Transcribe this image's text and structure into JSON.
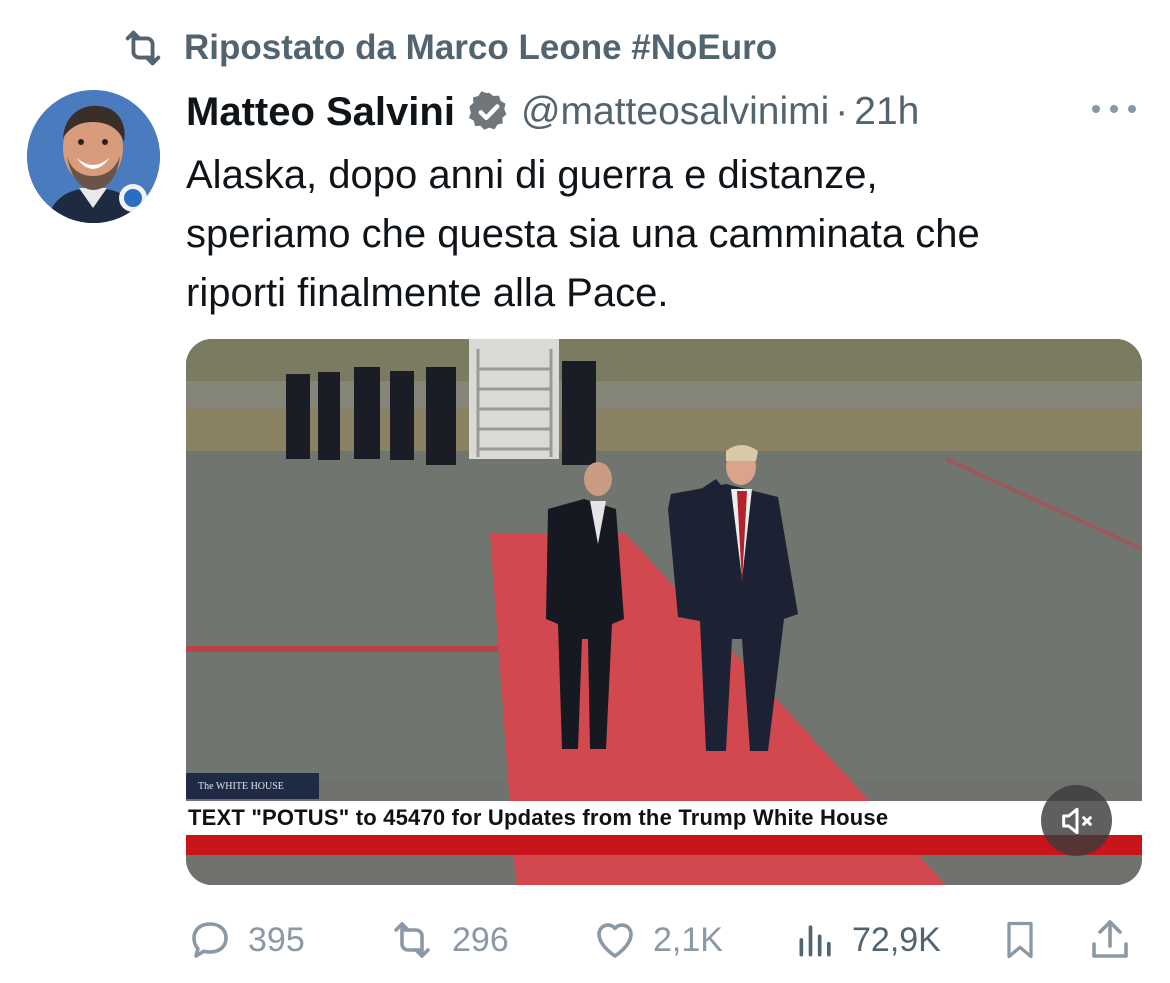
{
  "repost": {
    "label": "Ripostato da Marco Leone #NoEuro",
    "icon": "repost-icon"
  },
  "author": {
    "name": "Matteo Salvini",
    "handle": "@matteosalvinimi",
    "separator": "·",
    "time": "21h",
    "verified": true,
    "badge_color": "#71767b"
  },
  "tweet": {
    "text": "Alaska, dopo anni di guerra e distanze,\nsperiamo che questa sia una camminata che\nriporti finalmente alla Pace."
  },
  "media": {
    "tag_text": "The WHITE HOUSE",
    "ticker_text": "TEXT \"POTUS\" to 45470 for Updates from the Trump White House",
    "mute_icon": "speaker-muted-icon"
  },
  "actions": {
    "replies": "395",
    "reposts": "296",
    "likes": "2,1K",
    "views": "72,9K"
  },
  "colors": {
    "secondary_text": "#536471",
    "action_gray": "#8b98a5",
    "ticker_red": "#c8151b"
  }
}
